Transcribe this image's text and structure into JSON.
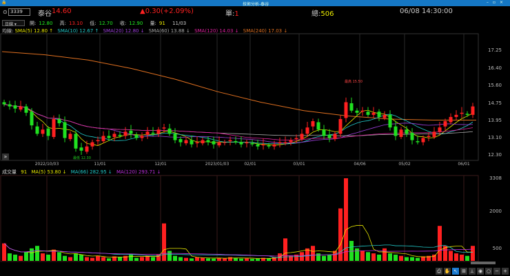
{
  "window": {
    "title": "技術分析-泰谷"
  },
  "header": {
    "code": "3339",
    "name": "泰谷",
    "price": "14.60",
    "change": "▲0.30(+2.09%)",
    "unit_label": "單:",
    "unit": "1",
    "total_label": "總:",
    "total": "506",
    "datetime": "06/08 14:30:00"
  },
  "toolbar": {
    "period": "日線",
    "open_label": "開:",
    "open": "12.80",
    "high_label": "高:",
    "high": "13.10",
    "low_label": "低:",
    "low": "12.70",
    "close_label": "收:",
    "close": "12.90",
    "vol_label": "量:",
    "vol": "91",
    "date": "11/03"
  },
  "ma_legend": {
    "label": "均線:",
    "items": [
      {
        "text": "SMA(5) 12.80 ↑",
        "color": "#e8e800"
      },
      {
        "text": "SMA(10) 12.67 ↑",
        "color": "#22cccc"
      },
      {
        "text": "SMA(20) 12.80 ↓",
        "color": "#a040e0"
      },
      {
        "text": "SMA(60) 13.88 ↓",
        "color": "#aaaaaa"
      },
      {
        "text": "SMA(120) 14.03 ↓",
        "color": "#e020a0"
      },
      {
        "text": "SMA(240) 17.03 ↓",
        "color": "#e07020"
      }
    ]
  },
  "price_axis": [
    "17.25",
    "16.40",
    "15.60",
    "14.75",
    "13.95",
    "13.10",
    "12.30"
  ],
  "dates": [
    "2022/10/03",
    "11/01",
    "12/01",
    "2023/01/03",
    "02/01",
    "03/01",
    "04/06",
    "05/02",
    "06/01"
  ],
  "annotations": {
    "high": "最高 15.50",
    "low": "最低 12.30"
  },
  "vol_legend": {
    "label": "成交量",
    "value": "91",
    "items": [
      {
        "text": "MA(5) 53.80 ↓",
        "color": "#e8e800"
      },
      {
        "text": "MA(66) 282.95 ↓",
        "color": "#22cccc"
      },
      {
        "text": "MA(120) 293.71 ↓",
        "color": "#c030e0"
      }
    ]
  },
  "vol_axis": [
    "3308",
    "2000",
    "500"
  ],
  "colors": {
    "up": "#ff2020",
    "down": "#20e020",
    "sma240": "#e07020"
  },
  "chart_data": {
    "type": "candlestick",
    "closes": [
      14.7,
      14.6,
      14.5,
      14.6,
      14.3,
      13.7,
      13.3,
      13.5,
      13.2,
      14.0,
      13.8,
      13.1,
      13.3,
      12.6,
      12.5,
      12.7,
      12.9,
      13.0,
      13.2,
      13.1,
      13.3,
      13.2,
      13.4,
      13.3,
      13.1,
      13.2,
      13.4,
      13.3,
      13.5,
      13.6,
      13.3,
      13.0,
      12.9,
      13.0,
      12.8,
      12.9,
      13.0,
      12.9,
      12.8,
      12.9,
      12.9,
      13.0,
      12.9,
      12.8,
      12.9,
      12.8,
      12.7,
      12.8,
      12.7,
      12.8,
      12.9,
      12.9,
      13.0,
      13.1,
      13.3,
      13.6,
      13.9,
      13.5,
      13.2,
      13.1,
      13.3,
      14.0,
      14.8,
      14.4,
      14.3,
      14.4,
      14.2,
      14.3,
      14.1,
      14.2,
      13.6,
      13.2,
      13.5,
      13.3,
      13.0,
      12.9,
      13.1,
      13.2,
      13.4,
      13.6,
      13.9,
      14.1,
      14.2,
      14.3,
      14.2,
      14.6
    ],
    "volumes": [
      700,
      300,
      250,
      200,
      350,
      500,
      600,
      300,
      250,
      450,
      350,
      200,
      150,
      300,
      250,
      150,
      120,
      200,
      150,
      100,
      180,
      150,
      200,
      250,
      120,
      150,
      200,
      150,
      250,
      1500,
      400,
      200,
      150,
      120,
      100,
      150,
      120,
      100,
      90,
      120,
      100,
      150,
      120,
      90,
      100,
      80,
      90,
      120,
      100,
      150,
      300,
      900,
      200,
      250,
      350,
      500,
      600,
      300,
      200,
      250,
      400,
      2100,
      3308,
      800,
      500,
      400,
      350,
      300,
      250,
      500,
      300,
      250,
      200,
      150,
      150,
      120,
      180,
      200,
      250,
      1400,
      600,
      400,
      300,
      250,
      200,
      600
    ],
    "sma240": [
      17.2,
      17.05,
      16.8,
      16.4,
      15.9,
      15.3,
      14.8,
      14.4,
      14.15,
      14.0,
      13.95,
      13.95
    ],
    "ylim": [
      12.0,
      17.6
    ],
    "vol_ylim": [
      0,
      3308
    ]
  }
}
